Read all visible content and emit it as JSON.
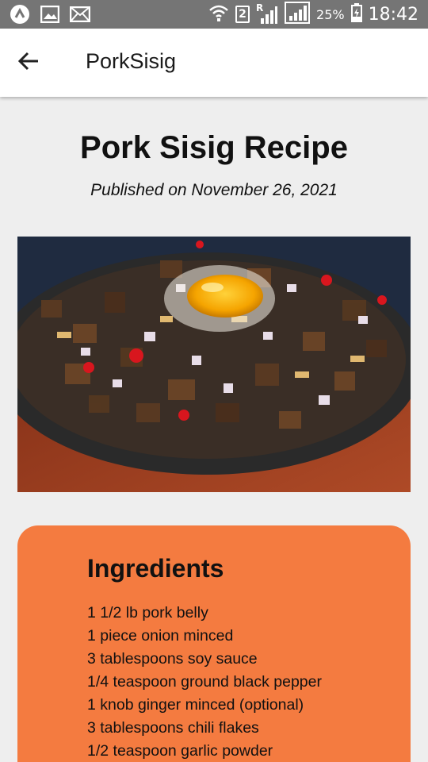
{
  "status_bar": {
    "battery_percent": "25%",
    "time": "18:42",
    "sim_number": "2",
    "roaming": "R",
    "icons": [
      "app-icon",
      "gallery-icon",
      "mail-icon",
      "wifi-icon",
      "sim-icon",
      "signal-icon",
      "signal-icon",
      "battery-icon"
    ]
  },
  "app_bar": {
    "title": "PorkSisig",
    "back_icon": "arrow-left-icon"
  },
  "recipe": {
    "title": "Pork Sisig Recipe",
    "published": "Published on November 26, 2021"
  },
  "ingredients": {
    "heading": "Ingredients",
    "items": [
      "1 1/2 lb pork belly",
      "1 piece onion minced",
      "3 tablespoons soy sauce",
      "1/4 teaspoon ground black pepper",
      "1 knob ginger minced (optional)",
      "3 tablespoons chili flakes",
      "1/2 teaspoon garlic powder"
    ]
  },
  "colors": {
    "status_bar": "#757575",
    "app_bar": "#ffffff",
    "background": "#eeeeee",
    "ingredients_card": "#f47b40"
  }
}
